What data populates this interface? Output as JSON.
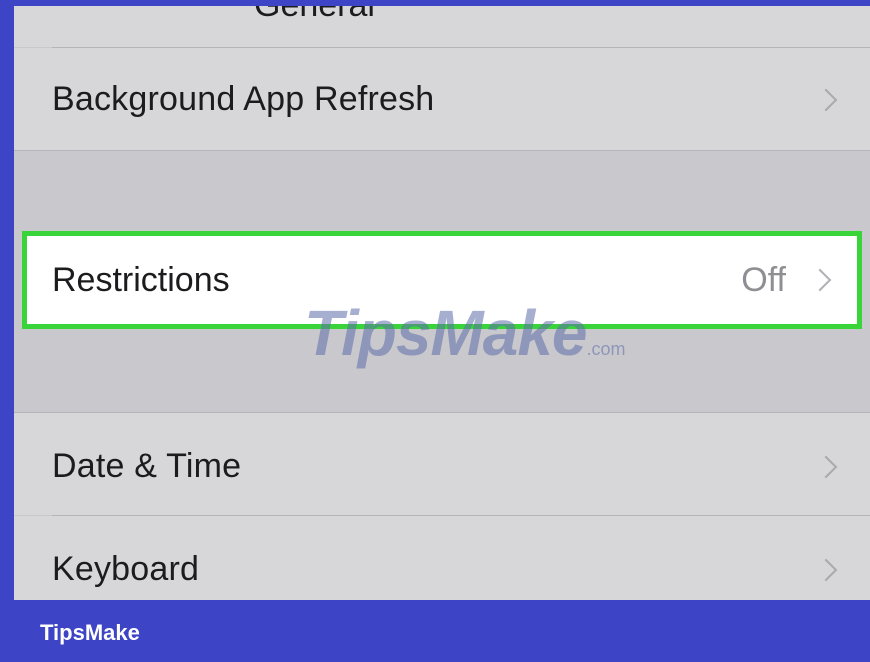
{
  "settings": {
    "top_fragment": "General",
    "rows": [
      {
        "label": "Background App Refresh"
      },
      {
        "label": "Restrictions",
        "value": "Off"
      },
      {
        "label": "Date & Time"
      },
      {
        "label": "Keyboard"
      }
    ]
  },
  "watermark": {
    "main": "TipsMake",
    "suffix": ".com"
  },
  "footer": {
    "brand": "TipsMake"
  },
  "colors": {
    "frame": "#3d45c6",
    "highlight_border": "#39d43a",
    "cell_bg": "#d7d7da",
    "group_bg": "#c9c9cd"
  }
}
